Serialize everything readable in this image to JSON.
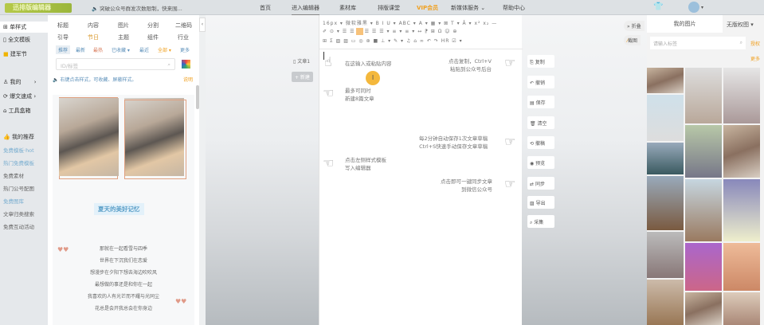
{
  "topbar": {
    "logo": "迅排版编辑器",
    "announcement": "突破公众号群发次数限制，快来围...",
    "nav": [
      "首页",
      "进入编辑器",
      "素材库",
      "排版课堂",
      "VIP会员",
      "新媒体服务 ⌄",
      "帮助中心"
    ]
  },
  "sidebar": {
    "main": [
      "单样式",
      "全文模板",
      "建军节"
    ],
    "menu": [
      "我的",
      "爆文速成",
      "工具盒箱"
    ],
    "recommend_title": "我的推荐",
    "recommend": [
      "免费模板·hot",
      "热门免费模板",
      "免费素材",
      "热门公号配图",
      "免费图库",
      "文章归类搜索",
      "免费互动活动"
    ]
  },
  "panel": {
    "categories": [
      "标题",
      "内容",
      "图片",
      "分割",
      "二维码",
      "引导",
      "节日",
      "主题",
      "组件",
      "行业"
    ],
    "filters": [
      "推荐",
      "最新",
      "最热",
      "已收藏 ▾",
      "最近",
      "全部 ▾",
      "更多"
    ],
    "search_placeholder": "ID/标签",
    "tip": "右键点击样式，可收藏、屏蔽样式。",
    "tip_link": "说明",
    "article_title": "夏天的美好记忆",
    "poem": [
      "那就在一起看雪与四季",
      "世界在下沉我们在恋爱",
      "想漫步在夕阳下想去海边吹吹风",
      "最想做的事还是和你在一起",
      "我喜欢的人有光芒而不耀与光同尘",
      "花总是会开我总会在你身边"
    ]
  },
  "doc": {
    "tab": "文章1",
    "new": "+ 新建"
  },
  "toolbar": {
    "row1": "16px ▾ 微软雅黑 ▾  B  I  U ▾ ABC ▾ A ▾ ▦ ▾ ⊠ T ▾ Ā ▾ x² x₂ —",
    "row2": "✐ ⊙ ▾ ☰ ☰ ☰ ☰ ☰ ☰ ▾ ≡ ▾ ≡ ▾ ↔ ⁋ ⊞ Ω ☺ ⊕",
    "row3": "⊞ Σ ▨ ▨ ▭ ◎ ⊛ ■ ⊥ ▾ ✎ ▾ ♫ ⌂ ∞ ↶ ↷ HR ☑ ▾"
  },
  "hints": {
    "h1": "在这输入或粘贴内容",
    "h2a": "最多可同时",
    "h2b": "新建8篇文章",
    "h3a": "点击复制，Ctrl+V",
    "h3b": "粘贴到公众号后台",
    "h4a": "每2分钟自动保存1次文章草稿",
    "h4b": "Ctrl+S快速手动保存文章草稿",
    "h5a": "点击左侧样式模板",
    "h5b": "写入编辑器",
    "h6a": "点击即可一键同步文章",
    "h6b": "到微信公众号"
  },
  "actions": [
    "复制",
    "撤销",
    "保存",
    "清空",
    "撤稿",
    "预览",
    "同步",
    "导出",
    "采集"
  ],
  "side_buttons": {
    "fold": "» 折叠",
    "screenshot": "截图"
  },
  "right": {
    "tab1": "我的图片",
    "tab2": "无版权图 ▾",
    "search_placeholder": "请输入标签",
    "link1": "授权",
    "link2": "更多"
  }
}
